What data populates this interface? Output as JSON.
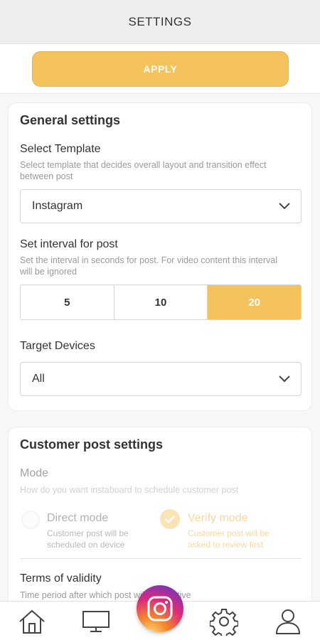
{
  "header": {
    "title": "SETTINGS"
  },
  "apply": {
    "label": "APPLY"
  },
  "general": {
    "title": "General settings",
    "template": {
      "label": "Select Template",
      "hint": "Select template that decides overall layout and transition effect between post",
      "value": "Instagram"
    },
    "interval": {
      "label": "Set interval for post",
      "hint": "Set the interval in seconds for post. For video content this interval will be ignored",
      "options": [
        "5",
        "10",
        "20"
      ],
      "selected": "20"
    },
    "devices": {
      "label": "Target Devices",
      "value": "All"
    }
  },
  "customer": {
    "title": "Customer post settings",
    "mode": {
      "label": "Mode",
      "hint": "How do you want instaboard to schedule customer post",
      "direct": {
        "title": "Direct mode",
        "desc": "Customer post will be scheduled on device"
      },
      "verify": {
        "title": "Verify mode",
        "desc": "Customer post will be asked to review first"
      }
    },
    "validity": {
      "label": "Terms of validity",
      "hint": "Time period after which post will be inactive"
    }
  },
  "nav": {
    "items": [
      "home-icon",
      "monitor-icon",
      "instagram-icon",
      "gear-icon",
      "user-icon"
    ],
    "active": "gear-icon",
    "accent": "#f5c35c"
  }
}
